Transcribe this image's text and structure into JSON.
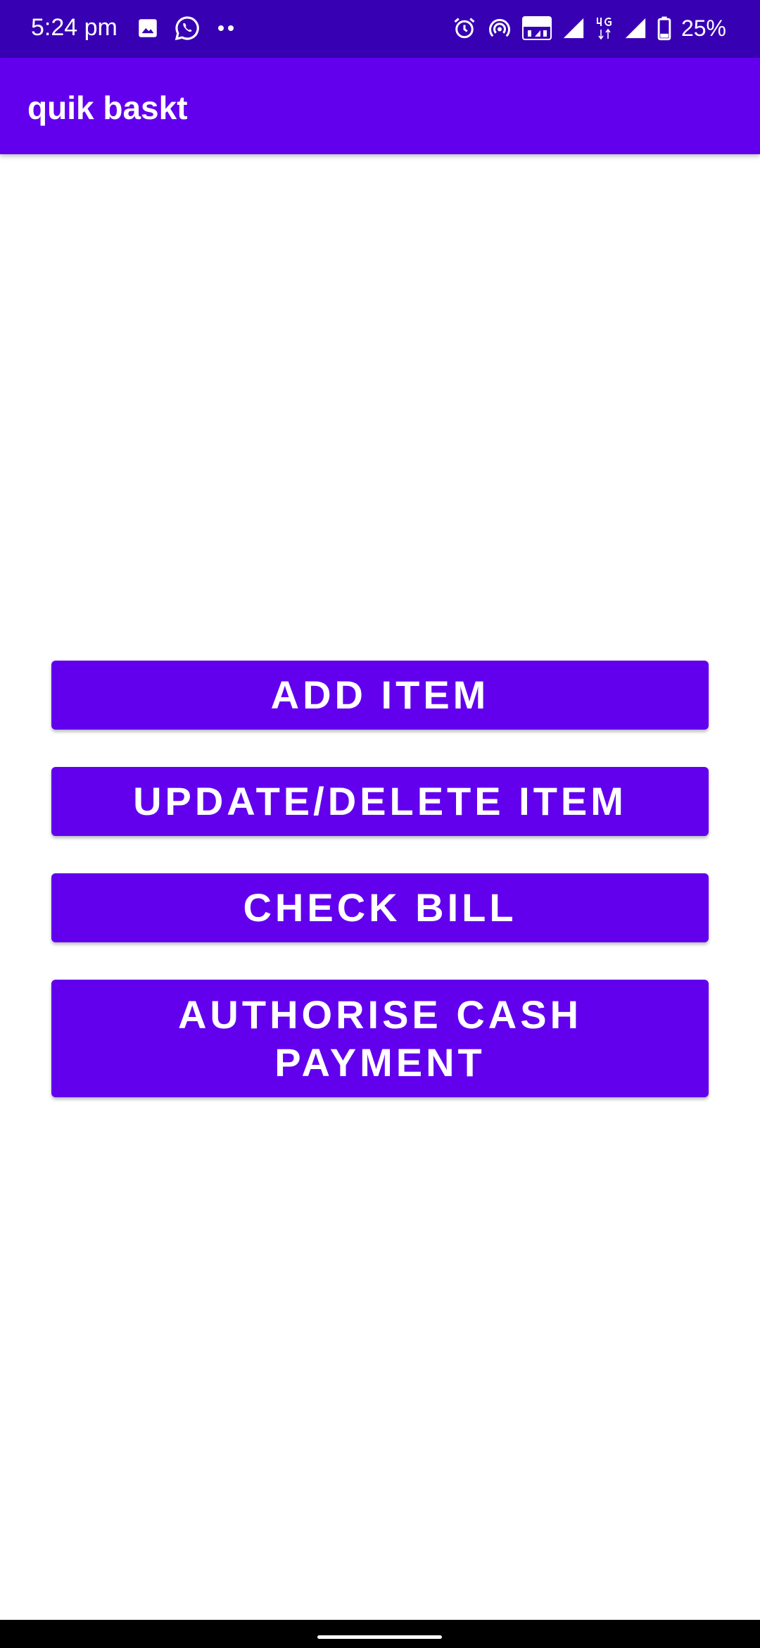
{
  "status_bar": {
    "time": "5:24 pm",
    "left_icons": [
      "image-icon",
      "whatsapp-icon",
      "more-notifications-icon"
    ],
    "right_icons": [
      "alarm-icon",
      "hotspot-icon",
      "volte-icon",
      "signal-icon",
      "4g-icon",
      "signal-icon",
      "battery-icon"
    ],
    "battery": "25%"
  },
  "app_bar": {
    "title": "quik baskt"
  },
  "actions": {
    "add_item": "ADD ITEM",
    "update_delete_item": "UPDATE/DELETE ITEM",
    "check_bill": "CHECK BILL",
    "authorise_cash_payment": "AUTHORISE CASH PAYMENT"
  },
  "colors": {
    "status_bar": "#3700B3",
    "primary": "#6200EE",
    "background": "#FFFFFF",
    "nav_bar": "#000000"
  }
}
